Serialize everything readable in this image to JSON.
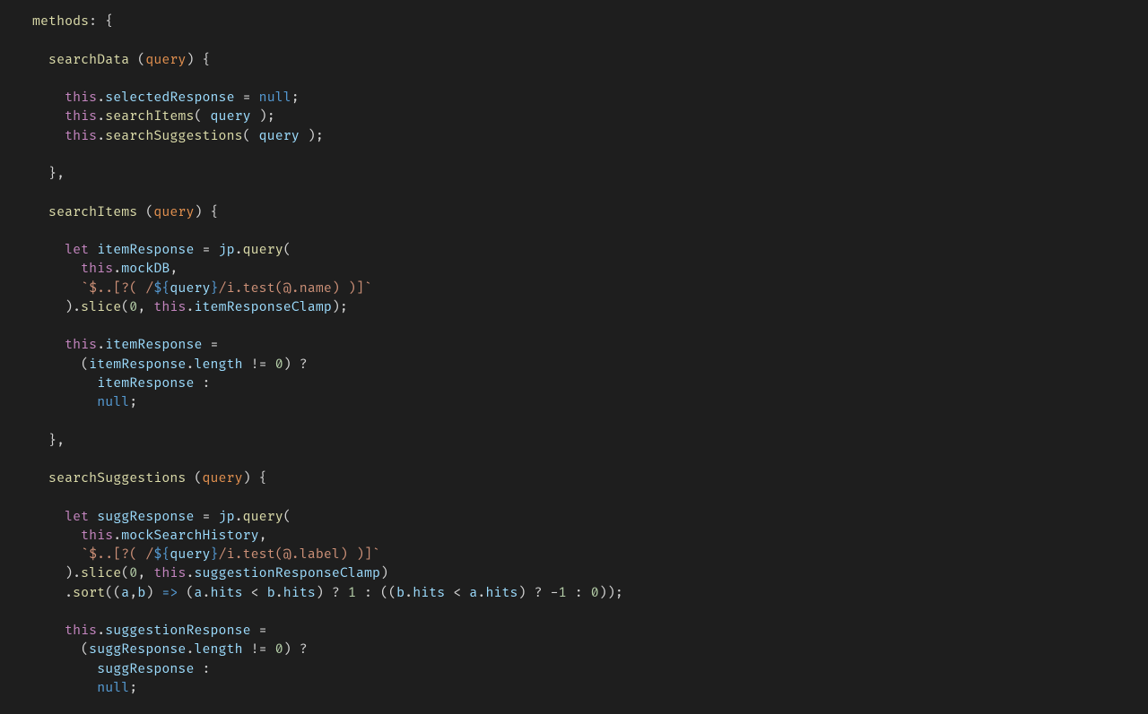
{
  "colors": {
    "background": "#1e1e1e",
    "default": "#d4d4d4",
    "function": "#dcdcaa",
    "identifier": "#9cdcfe",
    "parameter": "#e2904f",
    "keyword": "#c586c0",
    "null": "#569cd6",
    "number": "#b5cea8",
    "string": "#ce9178",
    "interp": "#569cd6"
  },
  "lines": [
    [
      [
        "def",
        "methods"
      ],
      [
        "punc",
        ": {"
      ]
    ],
    [],
    [
      [
        "punc",
        "  "
      ],
      [
        "def",
        "searchData"
      ],
      [
        "punc",
        " ("
      ],
      [
        "param",
        "query"
      ],
      [
        "punc",
        ") {"
      ]
    ],
    [],
    [
      [
        "punc",
        "    "
      ],
      [
        "key",
        "this"
      ],
      [
        "punc",
        "."
      ],
      [
        "ident",
        "selectedResponse"
      ],
      [
        "punc",
        " = "
      ],
      [
        "null",
        "null"
      ],
      [
        "punc",
        ";"
      ]
    ],
    [
      [
        "punc",
        "    "
      ],
      [
        "key",
        "this"
      ],
      [
        "punc",
        "."
      ],
      [
        "def",
        "searchItems"
      ],
      [
        "punc",
        "( "
      ],
      [
        "ident",
        "query"
      ],
      [
        "punc",
        " );"
      ]
    ],
    [
      [
        "punc",
        "    "
      ],
      [
        "key",
        "this"
      ],
      [
        "punc",
        "."
      ],
      [
        "def",
        "searchSuggestions"
      ],
      [
        "punc",
        "( "
      ],
      [
        "ident",
        "query"
      ],
      [
        "punc",
        " );"
      ]
    ],
    [],
    [
      [
        "punc",
        "  },"
      ]
    ],
    [],
    [
      [
        "punc",
        "  "
      ],
      [
        "def",
        "searchItems"
      ],
      [
        "punc",
        " ("
      ],
      [
        "param",
        "query"
      ],
      [
        "punc",
        ") {"
      ]
    ],
    [],
    [
      [
        "punc",
        "    "
      ],
      [
        "key",
        "let"
      ],
      [
        "punc",
        " "
      ],
      [
        "ident",
        "itemResponse"
      ],
      [
        "punc",
        " = "
      ],
      [
        "ident",
        "jp"
      ],
      [
        "punc",
        "."
      ],
      [
        "def",
        "query"
      ],
      [
        "punc",
        "("
      ]
    ],
    [
      [
        "punc",
        "      "
      ],
      [
        "key",
        "this"
      ],
      [
        "punc",
        "."
      ],
      [
        "ident",
        "mockDB"
      ],
      [
        "punc",
        ","
      ]
    ],
    [
      [
        "punc",
        "      "
      ],
      [
        "str",
        "`$..[?( /"
      ],
      [
        "strint",
        "${"
      ],
      [
        "ident",
        "query"
      ],
      [
        "strint",
        "}"
      ],
      [
        "str",
        "/i.test(@.name) )]`"
      ]
    ],
    [
      [
        "punc",
        "    )."
      ],
      [
        "def",
        "slice"
      ],
      [
        "punc",
        "("
      ],
      [
        "num",
        "0"
      ],
      [
        "punc",
        ", "
      ],
      [
        "key",
        "this"
      ],
      [
        "punc",
        "."
      ],
      [
        "ident",
        "itemResponseClamp"
      ],
      [
        "punc",
        ");"
      ]
    ],
    [],
    [
      [
        "punc",
        "    "
      ],
      [
        "key",
        "this"
      ],
      [
        "punc",
        "."
      ],
      [
        "ident",
        "itemResponse"
      ],
      [
        "punc",
        " ="
      ]
    ],
    [
      [
        "punc",
        "      ("
      ],
      [
        "ident",
        "itemResponse"
      ],
      [
        "punc",
        "."
      ],
      [
        "ident",
        "length"
      ],
      [
        "punc",
        " != "
      ],
      [
        "num",
        "0"
      ],
      [
        "punc",
        ") ?"
      ]
    ],
    [
      [
        "punc",
        "        "
      ],
      [
        "ident",
        "itemResponse"
      ],
      [
        "punc",
        " :"
      ]
    ],
    [
      [
        "punc",
        "        "
      ],
      [
        "null",
        "null"
      ],
      [
        "punc",
        ";"
      ]
    ],
    [],
    [
      [
        "punc",
        "  },"
      ]
    ],
    [],
    [
      [
        "punc",
        "  "
      ],
      [
        "def",
        "searchSuggestions"
      ],
      [
        "punc",
        " ("
      ],
      [
        "param",
        "query"
      ],
      [
        "punc",
        ") {"
      ]
    ],
    [],
    [
      [
        "punc",
        "    "
      ],
      [
        "key",
        "let"
      ],
      [
        "punc",
        " "
      ],
      [
        "ident",
        "suggResponse"
      ],
      [
        "punc",
        " = "
      ],
      [
        "ident",
        "jp"
      ],
      [
        "punc",
        "."
      ],
      [
        "def",
        "query"
      ],
      [
        "punc",
        "("
      ]
    ],
    [
      [
        "punc",
        "      "
      ],
      [
        "key",
        "this"
      ],
      [
        "punc",
        "."
      ],
      [
        "ident",
        "mockSearchHistory"
      ],
      [
        "punc",
        ","
      ]
    ],
    [
      [
        "punc",
        "      "
      ],
      [
        "str",
        "`$..[?( /"
      ],
      [
        "strint",
        "${"
      ],
      [
        "ident",
        "query"
      ],
      [
        "strint",
        "}"
      ],
      [
        "str",
        "/i.test(@.label) )]`"
      ]
    ],
    [
      [
        "punc",
        "    )."
      ],
      [
        "def",
        "slice"
      ],
      [
        "punc",
        "("
      ],
      [
        "num",
        "0"
      ],
      [
        "punc",
        ", "
      ],
      [
        "key",
        "this"
      ],
      [
        "punc",
        "."
      ],
      [
        "ident",
        "suggestionResponseClamp"
      ],
      [
        "punc",
        ")"
      ]
    ],
    [
      [
        "punc",
        "    ."
      ],
      [
        "def",
        "sort"
      ],
      [
        "punc",
        "(("
      ],
      [
        "ident",
        "a"
      ],
      [
        "punc",
        ","
      ],
      [
        "ident",
        "b"
      ],
      [
        "punc",
        ") "
      ],
      [
        "null",
        "=>"
      ],
      [
        "punc",
        " ("
      ],
      [
        "ident",
        "a"
      ],
      [
        "punc",
        "."
      ],
      [
        "ident",
        "hits"
      ],
      [
        "punc",
        " < "
      ],
      [
        "ident",
        "b"
      ],
      [
        "punc",
        "."
      ],
      [
        "ident",
        "hits"
      ],
      [
        "punc",
        ") ? "
      ],
      [
        "num",
        "1"
      ],
      [
        "punc",
        " : (("
      ],
      [
        "ident",
        "b"
      ],
      [
        "punc",
        "."
      ],
      [
        "ident",
        "hits"
      ],
      [
        "punc",
        " < "
      ],
      [
        "ident",
        "a"
      ],
      [
        "punc",
        "."
      ],
      [
        "ident",
        "hits"
      ],
      [
        "punc",
        ") ? -"
      ],
      [
        "num",
        "1"
      ],
      [
        "punc",
        " : "
      ],
      [
        "num",
        "0"
      ],
      [
        "punc",
        "));"
      ]
    ],
    [],
    [
      [
        "punc",
        "    "
      ],
      [
        "key",
        "this"
      ],
      [
        "punc",
        "."
      ],
      [
        "ident",
        "suggestionResponse"
      ],
      [
        "punc",
        " ="
      ]
    ],
    [
      [
        "punc",
        "      ("
      ],
      [
        "ident",
        "suggResponse"
      ],
      [
        "punc",
        "."
      ],
      [
        "ident",
        "length"
      ],
      [
        "punc",
        " != "
      ],
      [
        "num",
        "0"
      ],
      [
        "punc",
        ") ?"
      ]
    ],
    [
      [
        "punc",
        "        "
      ],
      [
        "ident",
        "suggResponse"
      ],
      [
        "punc",
        " :"
      ]
    ],
    [
      [
        "punc",
        "        "
      ],
      [
        "null",
        "null"
      ],
      [
        "punc",
        ";"
      ]
    ]
  ]
}
